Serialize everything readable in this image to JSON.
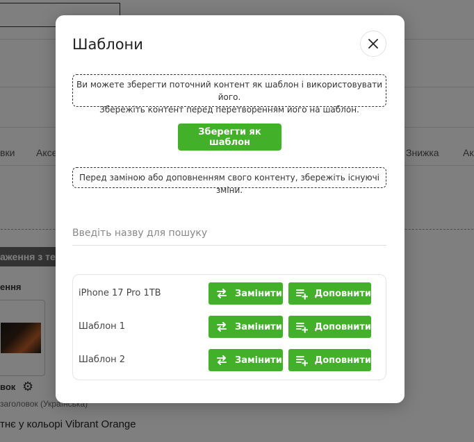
{
  "background": {
    "tabs": [
      "вки",
      "Аксе",
      "Знижка",
      "Акц"
    ],
    "section_label": "аження з те",
    "field_label_1": "ення",
    "field_label_2": "вок",
    "field_hint": "заголовок (Українська)",
    "product_text": "тнє у кольорі Vibrant Orange"
  },
  "modal": {
    "title": "Шаблони",
    "info_text_1": "Ви можете зберегти поточний контент як шаблон і використовувати його.",
    "info_text_2": "Збережіть контент перед перетворенням його на шаблон.",
    "save_button": "Зберегти як шаблон",
    "warning_text": "Перед заміною або доповненням свого контенту, збережіть існуючі зміни.",
    "search_placeholder": "Введіть назву для пошуку",
    "templates": [
      {
        "name": "iPhone 17 Pro 1TB",
        "replace": "Замінити",
        "append": "Доповнити"
      },
      {
        "name": "Шаблон 1",
        "replace": "Замінити",
        "append": "Доповнити"
      },
      {
        "name": "Шаблон 2",
        "replace": "Замінити",
        "append": "Доповнити"
      }
    ]
  },
  "colors": {
    "accent_green": "#43b02a",
    "overlay": "rgba(0,0,0,0.5)"
  },
  "icons": {
    "close": "close-icon",
    "replace": "swap-arrows-icon",
    "append": "playlist-add-icon",
    "gear": "gear-icon"
  }
}
